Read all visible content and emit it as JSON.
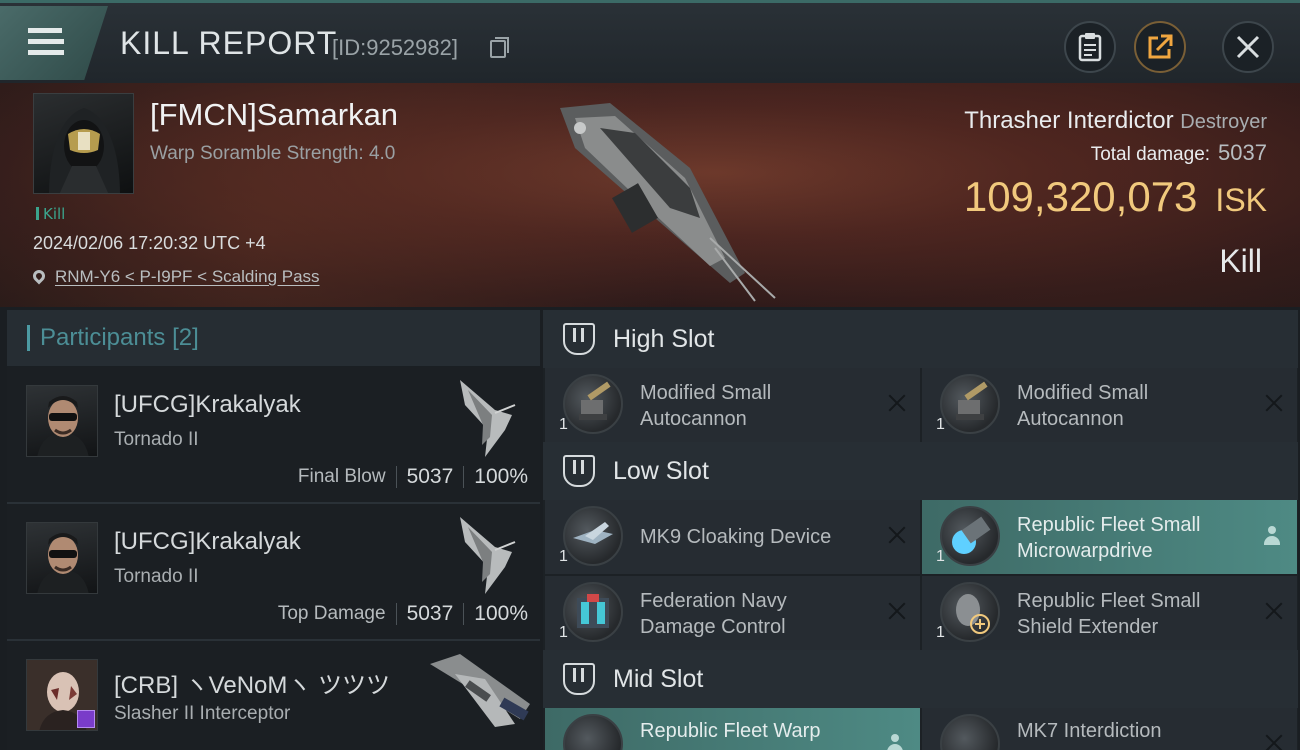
{
  "header": {
    "title": "KILL REPORT",
    "report_id": "[ID:9252982]",
    "icons": {
      "menu": "hamburger-menu-icon",
      "copy": "copy-icon",
      "clipboard": "clipboard-icon",
      "share": "share-icon",
      "close": "close-icon"
    }
  },
  "victim": {
    "name": "[FMCN]Samarkan",
    "subtitle": "Warp Soramble Strength: 4.0",
    "tag": "Kill",
    "timestamp": "2024/02/06 17:20:32 UTC +4",
    "location": "RNM-Y6 < P-I9PF < Scalding Pass",
    "ship_name": "Thrasher Interdictor",
    "ship_class": "Destroyer",
    "total_damage_label": "Total damage:",
    "total_damage": "5037",
    "isk_value": "109,320,073",
    "isk_unit": "ISK",
    "result": "Kill"
  },
  "participants": {
    "label": "Participants",
    "count": "[2]",
    "rows": [
      {
        "name": "[UFCG]Krakalyak",
        "ship": "Tornado II",
        "role": "Final Blow",
        "damage": "5037",
        "percent": "100%"
      },
      {
        "name": "[UFCG]Krakalyak",
        "ship": "Tornado II",
        "role": "Top Damage",
        "damage": "5037",
        "percent": "100%"
      },
      {
        "name": "[CRB] ヽVeNoMヽ ツツツ",
        "ship": "Slasher II Interceptor"
      }
    ]
  },
  "fittings": {
    "high_slot": {
      "label": "High Slot",
      "modules": [
        {
          "name_line1": "Modified Small",
          "name_line2": "Autocannon",
          "qty": "1"
        },
        {
          "name_line1": "Modified Small",
          "name_line2": "Autocannon",
          "qty": "1"
        }
      ]
    },
    "low_slot": {
      "label": "Low Slot",
      "modules": [
        {
          "name": "MK9 Cloaking Device",
          "qty": "1"
        },
        {
          "name_line1": "Republic Fleet Small",
          "name_line2": "Microwarpdrive",
          "qty": "1"
        },
        {
          "name_line1": "Federation Navy",
          "name_line2": "Damage Control",
          "qty": "1"
        },
        {
          "name_line1": "Republic Fleet Small",
          "name_line2": "Shield Extender",
          "qty": "1"
        }
      ]
    },
    "mid_slot": {
      "label": "Mid Slot",
      "modules": [
        {
          "name": "Republic Fleet Warp"
        },
        {
          "name": "MK7 Interdiction"
        }
      ]
    }
  },
  "colors": {
    "accent_teal": "#3ba58d",
    "isk_gold": "#f1c97d",
    "active_module": "#4e8a84"
  }
}
